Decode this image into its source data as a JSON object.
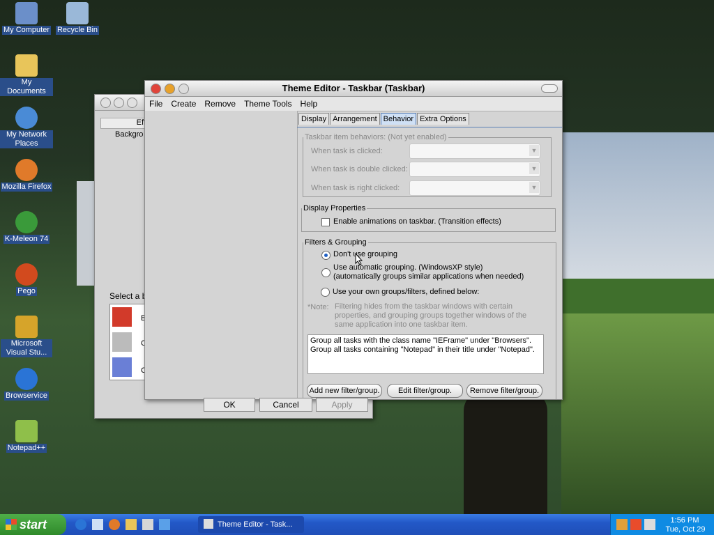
{
  "desktop": {
    "icons": [
      {
        "label": "My Computer",
        "color": "#6b8fc9"
      },
      {
        "label": "Recycle Bin",
        "color": "#9ab8d8"
      },
      {
        "label": "My Documents",
        "color": "#e8c55a"
      },
      {
        "label": "My Network Places",
        "color": "#4a8bd6"
      },
      {
        "label": "Mozilla Firefox",
        "color": "#e07a2a"
      },
      {
        "label": "K-Meleon 74",
        "color": "#3a9a3a"
      },
      {
        "label": "Pego",
        "color": "#d24a1e"
      },
      {
        "label": "Microsoft Visual Stu...",
        "color": "#d6a42a"
      },
      {
        "label": "Browservice",
        "color": "#2a74d6"
      },
      {
        "label": "Notepad++",
        "color": "#8fbf4a"
      }
    ]
  },
  "bg_window": {
    "tab_label": "Effe",
    "item_label": "Backgro",
    "select_label": "Select a b",
    "list_letters": [
      "B",
      "C",
      "C"
    ]
  },
  "main_window": {
    "title": "Theme Editor  -  Taskbar  (Taskbar)",
    "menu": [
      "File",
      "Create",
      "Remove",
      "Theme Tools",
      "Help"
    ],
    "tabs": [
      "Display",
      "Arrangement",
      "Behavior",
      "Extra Options"
    ],
    "active_tab": "Behavior",
    "behaviors": {
      "legend": "Taskbar item behaviors:  (Not yet enabled)",
      "rows": [
        "When task is clicked:",
        "When task is double clicked:",
        "When task is right clicked:"
      ]
    },
    "display_props": {
      "legend": "Display Properties",
      "checkbox_label": "Enable animations on taskbar. (Transition effects)",
      "checked": false
    },
    "filters": {
      "legend": "Filters & Grouping",
      "options": [
        "Don't use grouping",
        "Use automatic grouping. (WindowsXP style)",
        "Use your own groups/filters, defined below:"
      ],
      "option2_sub": "(automatically groups similar applications when needed)",
      "selected": 0,
      "note_prefix": "*Note:",
      "note": "Filtering hides from the taskbar windows with certain properties, and grouping groups together windows of the same application into one taskbar item.",
      "list_lines": [
        "Group all tasks with the class name \"IEFrame\" under \"Browsers\".",
        "Group all tasks containing \"Notepad\" in their title under \"Notepad\"."
      ],
      "buttons": [
        "Add new filter/group.",
        "Edit filter/group.",
        "Remove filter/group."
      ]
    },
    "footer_buttons": [
      "OK",
      "Cancel",
      "Apply"
    ]
  },
  "taskbar": {
    "start_label": "start",
    "task_label": "Theme Editor  -  Task...",
    "time": "1:56 PM",
    "date": "Tue, Oct 29"
  }
}
